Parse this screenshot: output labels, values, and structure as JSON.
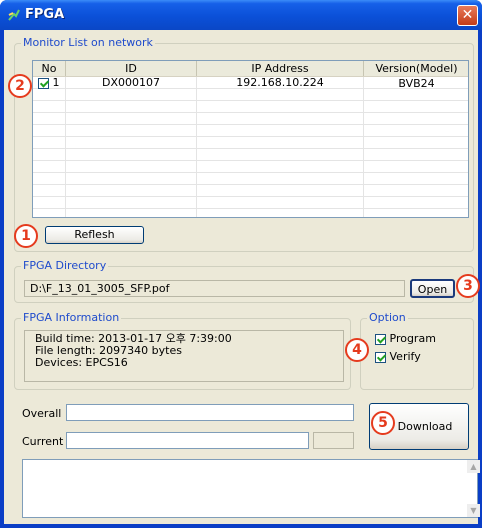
{
  "window": {
    "title": "FPGA",
    "close_glyph": "✕"
  },
  "monitor_list": {
    "legend": "Monitor List on network",
    "columns": [
      "No",
      "ID",
      "IP Address",
      "Version(Model)"
    ],
    "rows": [
      {
        "checked": true,
        "no": "1",
        "id": "DX000107",
        "ip": "192.168.10.224",
        "version": "BVB24"
      }
    ],
    "refresh_label": "Reflesh"
  },
  "directory": {
    "legend": "FPGA Directory",
    "path": "D:\\F_13_01_3005_SFP.pof",
    "open_label": "Open"
  },
  "info": {
    "legend": "FPGA Information",
    "build_time": "Build time: 2013-01-17 오후 7:39:00",
    "file_length": "File length: 2097340 bytes",
    "devices": "Devices: EPCS16"
  },
  "option": {
    "legend": "Option",
    "program_label": "Program",
    "program_checked": true,
    "verify_label": "Verify",
    "verify_checked": true
  },
  "progress": {
    "overall_label": "Overall",
    "current_label": "Current",
    "download_label": "Download"
  },
  "annotations": {
    "b1": "1",
    "b2": "2",
    "b3": "3",
    "b4": "4",
    "b5": "5"
  },
  "colors": {
    "titlebar": "#0a50d8",
    "legend": "#1f4bcc",
    "annotation": "#e53b1e",
    "dialog_bg": "#ece9d8"
  }
}
